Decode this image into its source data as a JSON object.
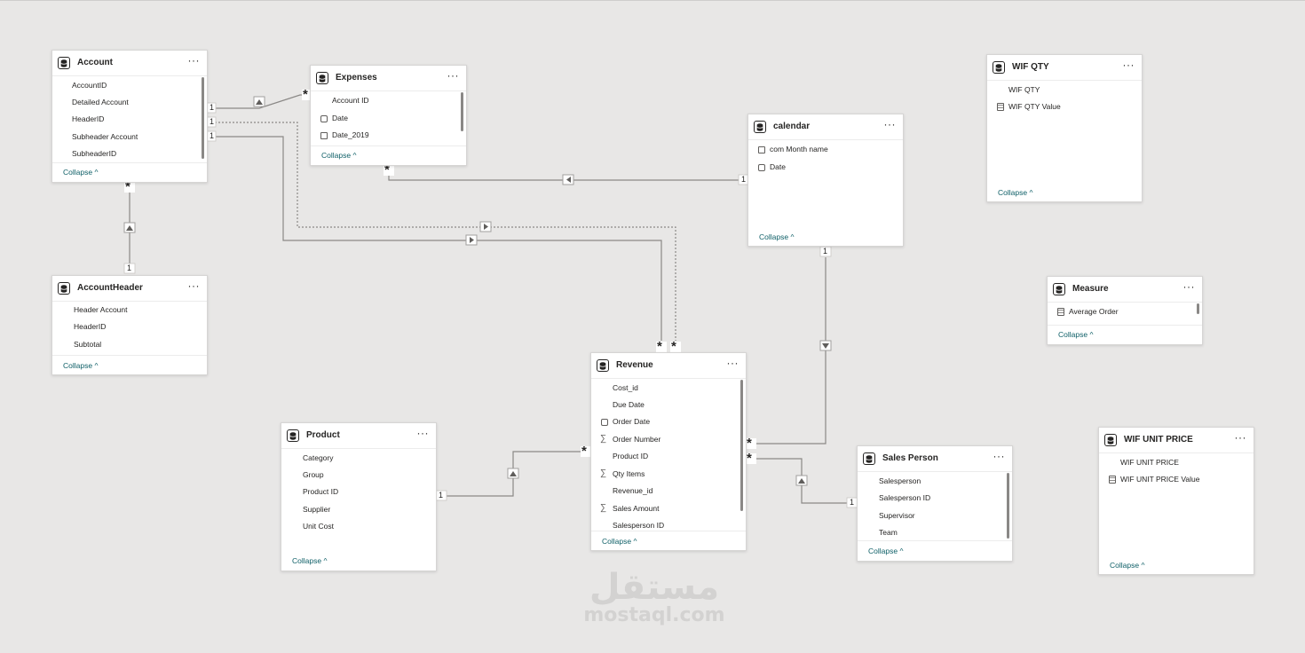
{
  "tables": {
    "account": {
      "title": "Account",
      "fields": [
        "AccountID",
        "Detailed Account",
        "HeaderID",
        "Subheader Account",
        "SubheaderID"
      ],
      "collapse_label": "Collapse"
    },
    "expenses": {
      "title": "Expenses",
      "fields": [
        "Account ID",
        "Date",
        "Date_2019"
      ],
      "collapse_label": "Collapse"
    },
    "calendar": {
      "title": "calendar",
      "fields": [
        "com Month name",
        "Date"
      ],
      "collapse_label": "Collapse"
    },
    "wif_qty": {
      "title": "WIF QTY",
      "fields": [
        "WIF QTY",
        "WIF QTY Value"
      ],
      "collapse_label": "Collapse"
    },
    "measure": {
      "title": "Measure",
      "fields": [
        "Average Order"
      ],
      "collapse_label": "Collapse"
    },
    "account_header": {
      "title": "AccountHeader",
      "fields": [
        "Header Account",
        "HeaderID",
        "Subtotal"
      ],
      "collapse_label": "Collapse"
    },
    "revenue": {
      "title": "Revenue",
      "fields": [
        "Cost_id",
        "Due Date",
        "Order Date",
        "Order Number",
        "Product ID",
        "Qty Items",
        "Revenue_id",
        "Sales Amount",
        "Salesperson ID"
      ],
      "collapse_label": "Collapse"
    },
    "product": {
      "title": "Product",
      "fields": [
        "Category",
        "Group",
        "Product ID",
        "Supplier",
        "Unit Cost"
      ],
      "collapse_label": "Collapse"
    },
    "sales_person": {
      "title": "Sales Person",
      "fields": [
        "Salesperson",
        "Salesperson ID",
        "Supervisor",
        "Team"
      ],
      "collapse_label": "Collapse"
    },
    "wif_unit_price": {
      "title": "WIF UNIT PRICE",
      "fields": [
        "WIF UNIT PRICE",
        "WIF UNIT PRICE Value"
      ],
      "collapse_label": "Collapse"
    }
  },
  "more_label": "···",
  "cardinality": {
    "one": "1",
    "many": "*"
  },
  "watermark": {
    "arabic": "مستقل",
    "latin": "mostaql.com"
  },
  "colors": {
    "canvas": "#e8e7e6",
    "card": "#ffffff",
    "link": "#8a8886",
    "collapse_text": "#0e5f67"
  }
}
